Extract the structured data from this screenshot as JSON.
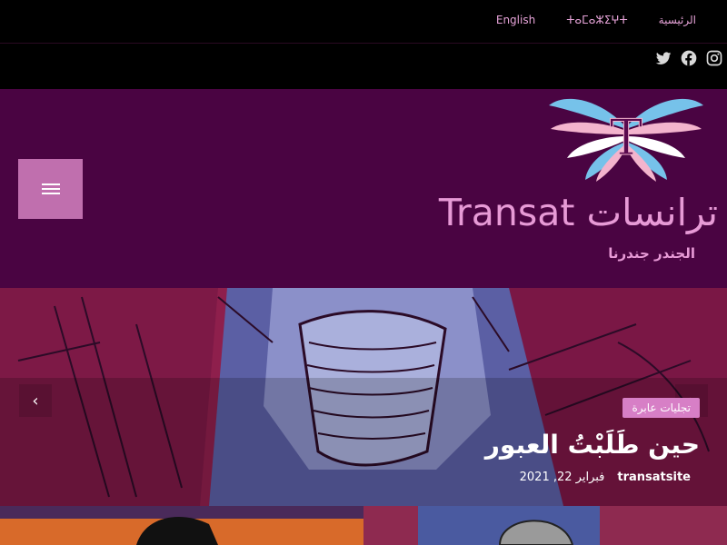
{
  "topnav": {
    "items": [
      "الرئيسية",
      "ⵜⴰⵎⴰⵣⵉⵖⵜ",
      "English"
    ]
  },
  "social": {
    "icons": [
      "instagram-icon",
      "facebook-icon",
      "twitter-icon"
    ]
  },
  "header": {
    "site_title": "ترانسات Transat",
    "tagline": "الجندر جندرنا",
    "logo_letter": "T",
    "colors": {
      "background": "#4a0442",
      "accent": "#e79ad6",
      "menu_button": "#c06fae"
    }
  },
  "hero": {
    "category": "تجليات عابرة",
    "title": "حين طَلَبْتُ العبور",
    "author": "transatsite",
    "date": "فبراير 22, 2021",
    "prev_arrow": "‹",
    "next_arrow": "›"
  }
}
